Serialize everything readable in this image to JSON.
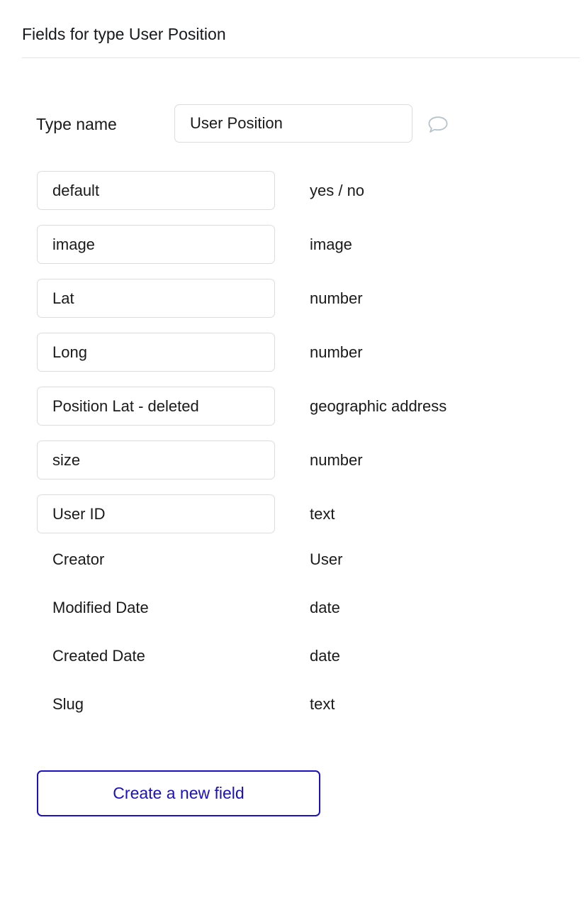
{
  "header": {
    "title": "Fields for type User Position"
  },
  "type_name_row": {
    "label": "Type name",
    "value": "User Position",
    "placeholder": "Type name",
    "comment_icon": "comment-bubble-icon",
    "comment_icon_color": "#b7c3ca"
  },
  "fields": [
    {
      "name": "default",
      "type": "yes / no",
      "editable": true
    },
    {
      "name": "image",
      "type": "image",
      "editable": true
    },
    {
      "name": "Lat",
      "type": "number",
      "editable": true
    },
    {
      "name": "Long",
      "type": "number",
      "editable": true
    },
    {
      "name": "Position Lat - deleted",
      "type": "geographic address",
      "editable": true
    },
    {
      "name": "size",
      "type": "number",
      "editable": true
    },
    {
      "name": "User ID",
      "type": "text",
      "editable": true
    },
    {
      "name": "Creator",
      "type": "User",
      "editable": false
    },
    {
      "name": "Modified Date",
      "type": "date",
      "editable": false
    },
    {
      "name": "Created Date",
      "type": "date",
      "editable": false
    },
    {
      "name": "Slug",
      "type": "text",
      "editable": false
    }
  ],
  "actions": {
    "create_field_label": "Create a new field"
  },
  "colors": {
    "accent": "#1b10c2",
    "border": "#dcdcdc",
    "divider": "#e3e3e3",
    "text": "#1a1a1a",
    "icon": "#b7c3ca"
  }
}
